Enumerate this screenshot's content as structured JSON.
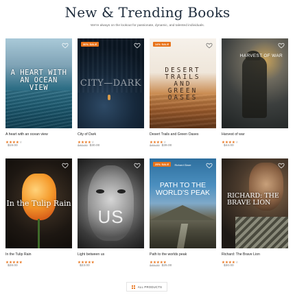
{
  "section": {
    "title": "New & Trending Books",
    "subtitle": "We're always on the lookout for passionate, dynamic, and talented individuals."
  },
  "colors": {
    "accent": "#e8731a",
    "heading": "#1f2d3d"
  },
  "books": [
    {
      "title": "A heart with an ocean view",
      "cover_text": "A HEART WITH AN OCEAN VIEW",
      "rating": 4,
      "old_price": "",
      "price": "$19.00",
      "badge": ""
    },
    {
      "title": "City of Dark",
      "cover_text": "CITY—DARK",
      "rating": 4,
      "old_price": "$40.00",
      "price": "$30.00",
      "badge": "30% SALE"
    },
    {
      "title": "Desert Trails and Green Oases",
      "cover_text": "DESERT TRAILS AND GREEN OASES",
      "rating": 4,
      "old_price": "$45.00",
      "price": "$39.00",
      "badge": "14% SALE"
    },
    {
      "title": "Harvest of war",
      "cover_text": "HARVEST OF WAR",
      "rating": 4,
      "old_price": "",
      "price": "$44.00",
      "badge": ""
    },
    {
      "title": "In the Tulip Rain",
      "cover_text": "In the Tulip Rain",
      "rating": 5,
      "old_price": "",
      "price": "$28.00",
      "badge": ""
    },
    {
      "title": "Light between us",
      "cover_text": "US",
      "rating": 5,
      "old_price": "",
      "price": "$23.00",
      "badge": ""
    },
    {
      "title": "Path to the worlds peak",
      "cover_text": "PATH TO THE WORLD'S PEAK",
      "cover_subtext": "Richard Glaze",
      "rating": 5,
      "old_price": "$45.00",
      "price": "$25.00",
      "badge": "25% SALE"
    },
    {
      "title": "Richard: The Brave Lion",
      "cover_text": "RICHARD: THE BRAVE LION",
      "rating": 4,
      "old_price": "",
      "price": "$30.00",
      "badge": ""
    }
  ],
  "all_products_button": {
    "label": "ALL PRODUCTS",
    "icon": "grid-icon"
  }
}
